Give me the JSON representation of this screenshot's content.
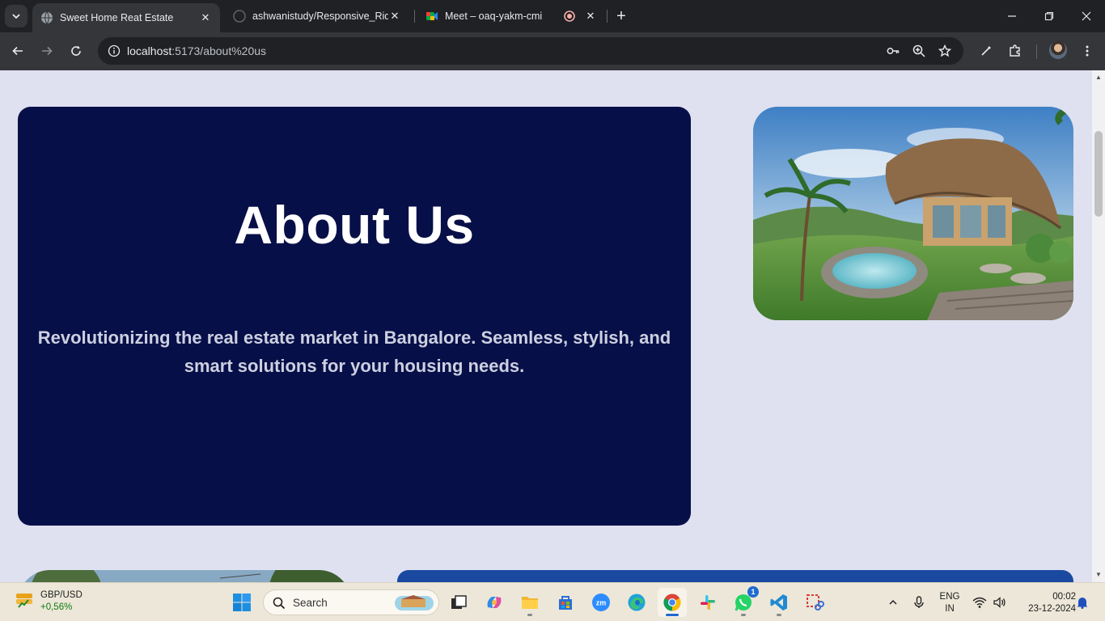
{
  "browser": {
    "tabs": [
      {
        "title": "Sweet Home Reat Estate",
        "active": true
      },
      {
        "title": "ashwanistudy/Responsive_Rider",
        "active": false
      },
      {
        "title": "Meet – oaq-yakm-cmi",
        "active": false
      }
    ],
    "url_host": "localhost",
    "url_path": ":5173/about%20us",
    "new_tab_symbol": "+"
  },
  "page": {
    "about_title": "About Us",
    "about_text": "Revolutionizing the real estate market in Bangalore. Seamless, stylish, and smart solutions for your housing needs."
  },
  "taskbar": {
    "widget": {
      "pair": "GBP/USD",
      "change": "+0,56%"
    },
    "search_placeholder": "Search",
    "whatsapp_badge": "1",
    "language": {
      "lang": "ENG",
      "region": "IN"
    },
    "clock": {
      "time": "00:02",
      "date": "23-12-2024"
    }
  },
  "colors": {
    "about_card_bg": "#070f48",
    "page_bg": "#dfe1f0",
    "blue_card": "#1a4aa0"
  }
}
